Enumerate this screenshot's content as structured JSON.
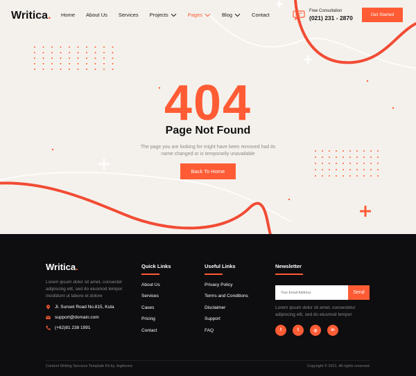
{
  "header": {
    "logo": "Writica",
    "logo_dot": ".",
    "nav": [
      {
        "label": "Home",
        "dropdown": false,
        "active": false
      },
      {
        "label": "About Us",
        "dropdown": false,
        "active": false
      },
      {
        "label": "Services",
        "dropdown": false,
        "active": false
      },
      {
        "label": "Projects",
        "dropdown": true,
        "active": false
      },
      {
        "label": "Pages",
        "dropdown": true,
        "active": true
      },
      {
        "label": "Blog",
        "dropdown": true,
        "active": false
      },
      {
        "label": "Contact",
        "dropdown": false,
        "active": false
      }
    ],
    "consult_label": "Free Consultation",
    "consult_phone": "(021) 231 - 2870",
    "cta_label": "Get Started"
  },
  "hero": {
    "code": "404",
    "title": "Page Not Found",
    "description": "The page you are looking for might have been removed had its name changed or is temporarily unavailable",
    "button_label": "Back To Home"
  },
  "footer": {
    "logo": "Writica",
    "logo_dot": ".",
    "description": "Lorem ipsum dolor sit amet, consectet adipiscing elit, sed do eiusmod tempor incididunt ut labore et dolore",
    "address": "Jl. Sunset Road No.815, Kuta",
    "email": "support@domain.com",
    "phone": "(+62)81 238 1991",
    "quick_links": {
      "heading": "Quick Links",
      "items": [
        "About Us",
        "Services",
        "Cases",
        "Pricing",
        "Contact"
      ]
    },
    "useful_links": {
      "heading": "Useful Links",
      "items": [
        "Privacy Policy",
        "Terms and Conditions",
        "Disclaimer",
        "Support",
        "FAQ"
      ]
    },
    "newsletter": {
      "heading": "Newsletter",
      "placeholder": "Your Email Address",
      "send_label": "Send",
      "description": "Lorem ipsum dolor sit amet, consectetur adipiscing elit, sed do eiusmod tempor"
    },
    "socials": [
      {
        "icon": "facebook-icon",
        "glyph": "f"
      },
      {
        "icon": "twitter-icon",
        "glyph": "t"
      },
      {
        "icon": "instagram-icon",
        "glyph": "◎"
      },
      {
        "icon": "linkedin-icon",
        "glyph": "in"
      }
    ],
    "copyright_left": "Content Writing Services Template Kit by Jegtheme",
    "copyright_right": "Copyright © 2021. All rights reserved."
  },
  "colors": {
    "accent": "#ff5c35",
    "hero_bg": "#f4f1ec",
    "footer_bg": "#0e0d0f"
  }
}
